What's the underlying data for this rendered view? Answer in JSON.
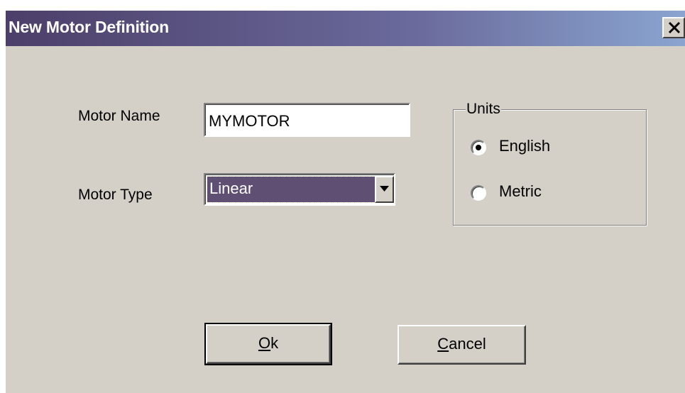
{
  "dialog": {
    "title": "New Motor Definition",
    "close_glyph": "✕"
  },
  "form": {
    "motor_name_label": "Motor Name",
    "motor_name_value": "MYMOTOR",
    "motor_type_label": "Motor Type",
    "motor_type_value": "Linear"
  },
  "units": {
    "legend": "Units",
    "options": [
      {
        "label": "English",
        "selected": true
      },
      {
        "label": "Metric",
        "selected": false
      }
    ]
  },
  "buttons": {
    "ok_label": "Ok",
    "cancel_label": "Cancel"
  },
  "icons": {
    "close": "close-icon",
    "dropdown": "chevron-down-icon"
  },
  "colors": {
    "dialog_bg": "#d4d0c8",
    "title_gradient_start": "#4c3f69",
    "title_gradient_end": "#8aa5cf",
    "selection_bg": "#5e4f73"
  }
}
